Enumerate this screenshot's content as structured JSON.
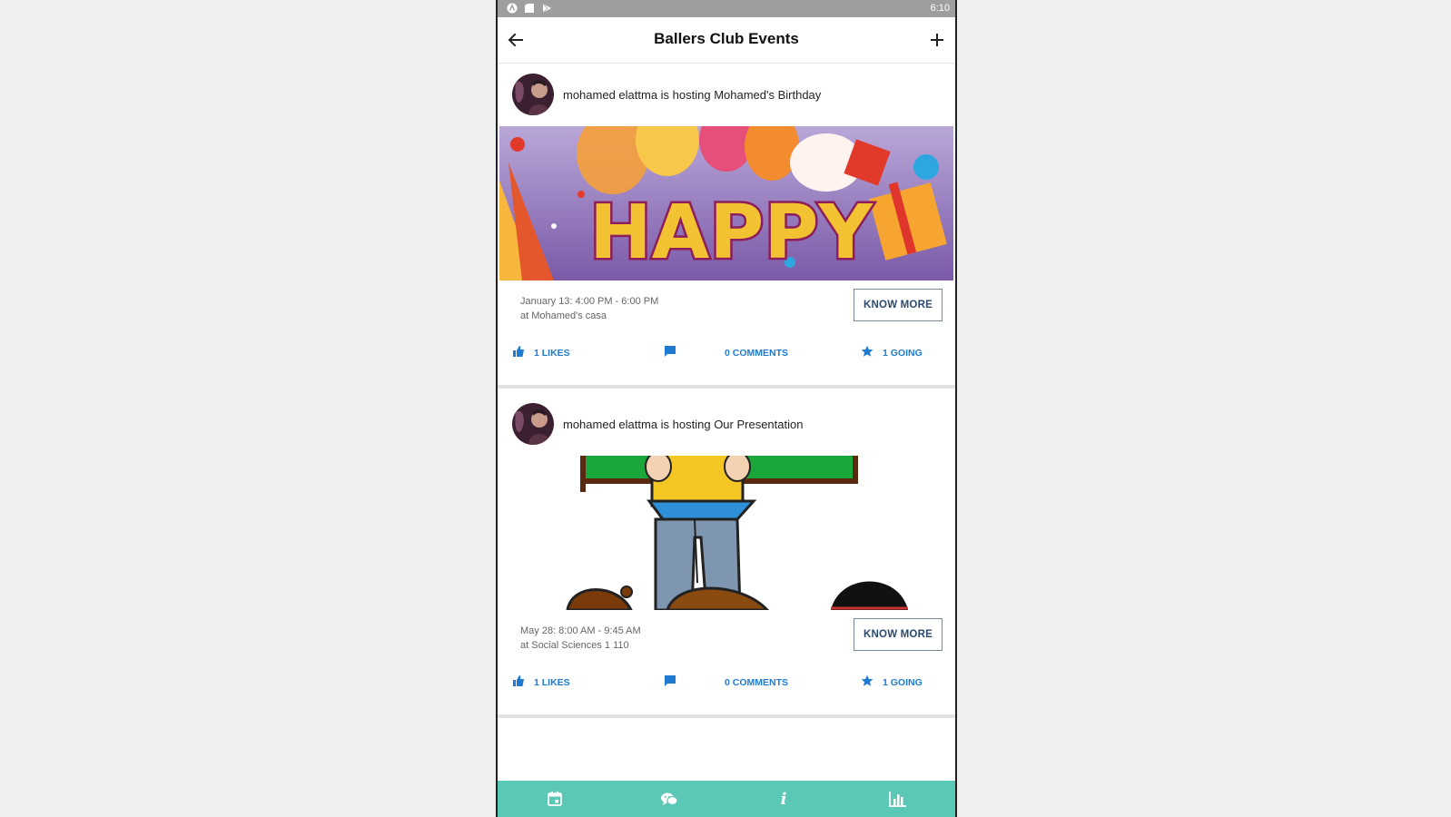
{
  "status_bar": {
    "time": "6:10",
    "icons": [
      "android-icon",
      "sd-card-icon",
      "play-store-icon"
    ]
  },
  "app_bar": {
    "title": "Ballers Club Events",
    "left_icon": "back-arrow-icon",
    "right_icon": "plus-icon"
  },
  "events": [
    {
      "host_line": "mohamed elattma is hosting Mohamed's Birthday",
      "banner_text": "HAPPY",
      "when": "January 13: 4:00 PM - 6:00 PM",
      "where": "at Mohamed's casa",
      "know_more": "KNOW MORE",
      "likes": "1 LIKES",
      "comments": "0 COMMENTS",
      "going": "1 GOING"
    },
    {
      "host_line": "mohamed elattma is hosting Our Presentation",
      "when": "May 28: 8:00 AM - 9:45 AM",
      "where": "at Social Sciences 1 110",
      "know_more": "KNOW MORE",
      "likes": "1 LIKES",
      "comments": "0 COMMENTS",
      "going": "1 GOING"
    }
  ],
  "bottom_nav": {
    "items": [
      "calendar-icon",
      "chat-icon",
      "info-icon",
      "bar-chart-icon"
    ],
    "info_glyph": "i"
  },
  "colors": {
    "accent": "#1e7bd1",
    "bottom_nav": "#5bc8b5",
    "status_bar": "#9e9e9e"
  }
}
